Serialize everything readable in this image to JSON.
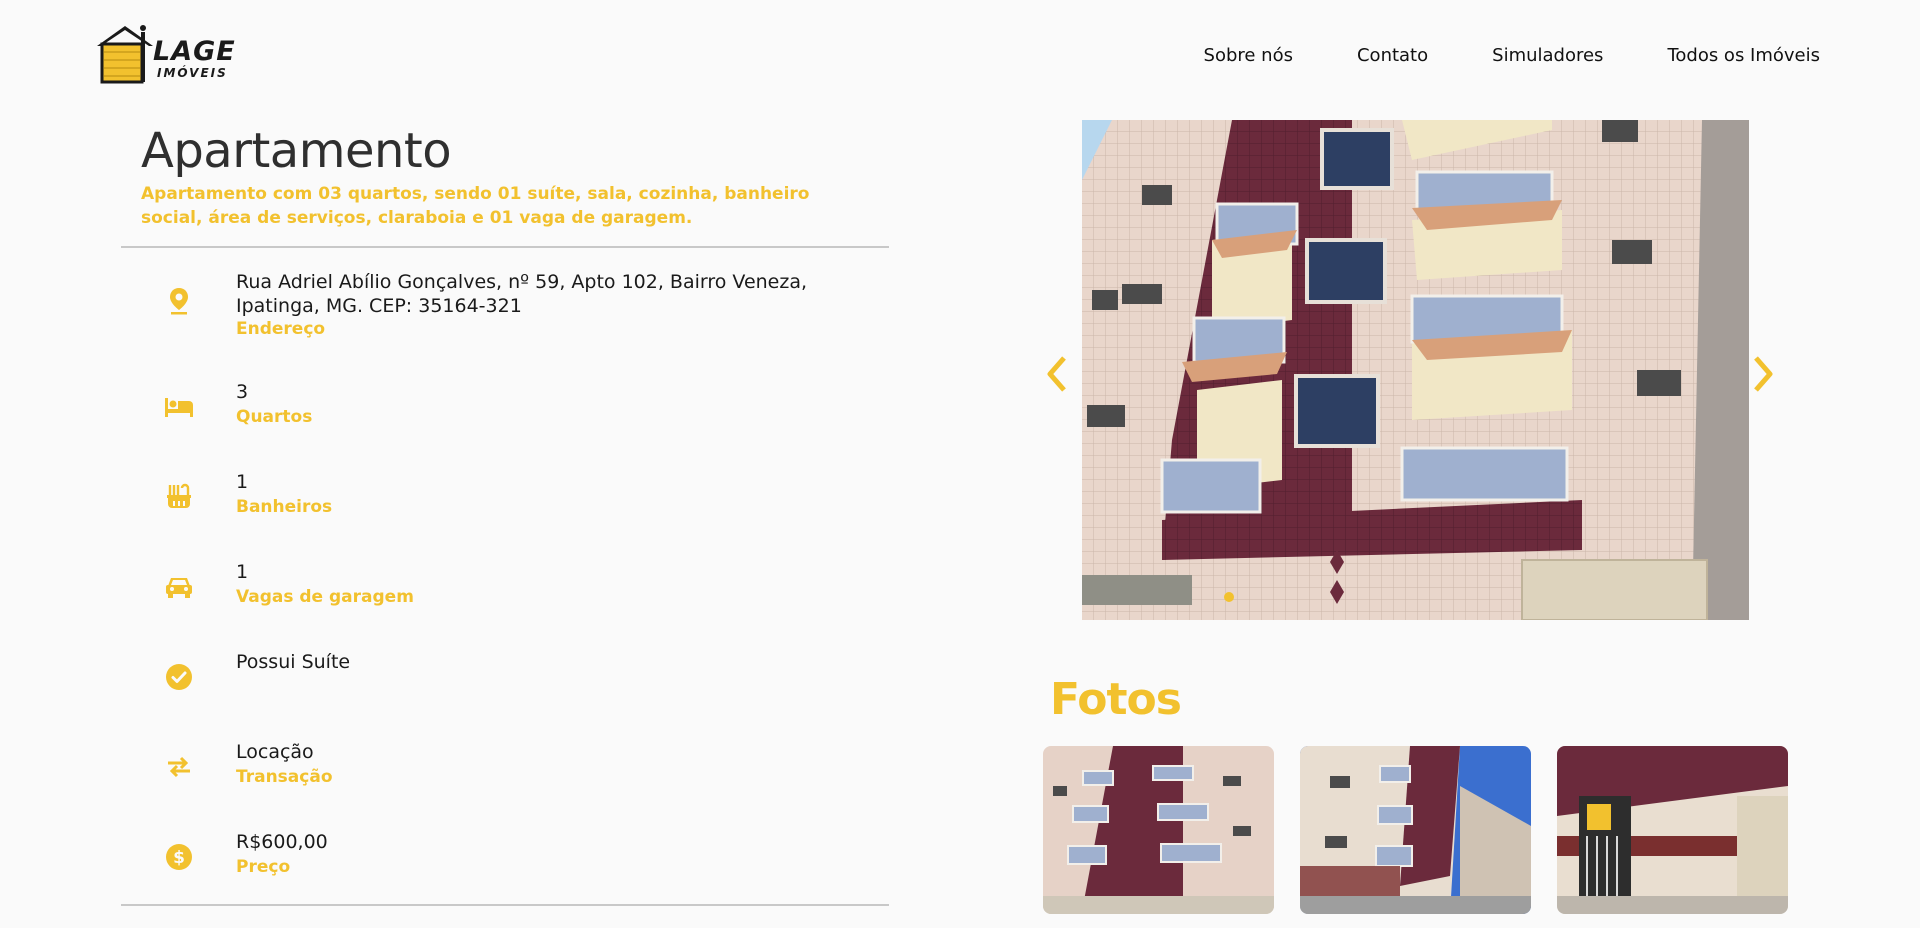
{
  "brand": {
    "name": "LAGE",
    "tagline": "IMÓVEIS",
    "accent_color": "#f2c12e",
    "icon": "house-logo-icon"
  },
  "nav": {
    "items": [
      "Sobre nós",
      "Contato",
      "Simuladores",
      "Todos os Imóveis"
    ]
  },
  "property": {
    "title": "Apartamento",
    "description": "Apartamento com 03 quartos, sendo 01 suíte, sala, cozinha, banheiro social, área de serviços, claraboia e 01 vaga de garagem.",
    "features": [
      {
        "icon": "location-pin-icon",
        "value": "Rua Adriel Abílio Gonçalves, nº 59, Apto 102, Bairro Veneza, Ipatinga, MG. CEP: 35164-321",
        "label": "Endereço"
      },
      {
        "icon": "bed-icon",
        "value": "3",
        "label": "Quartos"
      },
      {
        "icon": "bathtub-icon",
        "value": "1",
        "label": "Banheiros"
      },
      {
        "icon": "car-icon",
        "value": "1",
        "label": "Vagas de garagem"
      },
      {
        "icon": "check-circle-icon",
        "value": "Possui Suíte",
        "label": ""
      },
      {
        "icon": "swap-arrows-icon",
        "value": "Locação",
        "label": "Transação"
      },
      {
        "icon": "dollar-coin-icon",
        "value": "R$600,00",
        "label": "Preço"
      }
    ]
  },
  "carousel": {
    "prev_icon": "chevron-left-icon",
    "next_icon": "chevron-right-icon",
    "slide_count": 1,
    "active_index": 0
  },
  "gallery": {
    "title": "Fotos",
    "thumbnails": [
      "building-front-photo",
      "building-side-photo",
      "garage-entrance-photo"
    ]
  }
}
